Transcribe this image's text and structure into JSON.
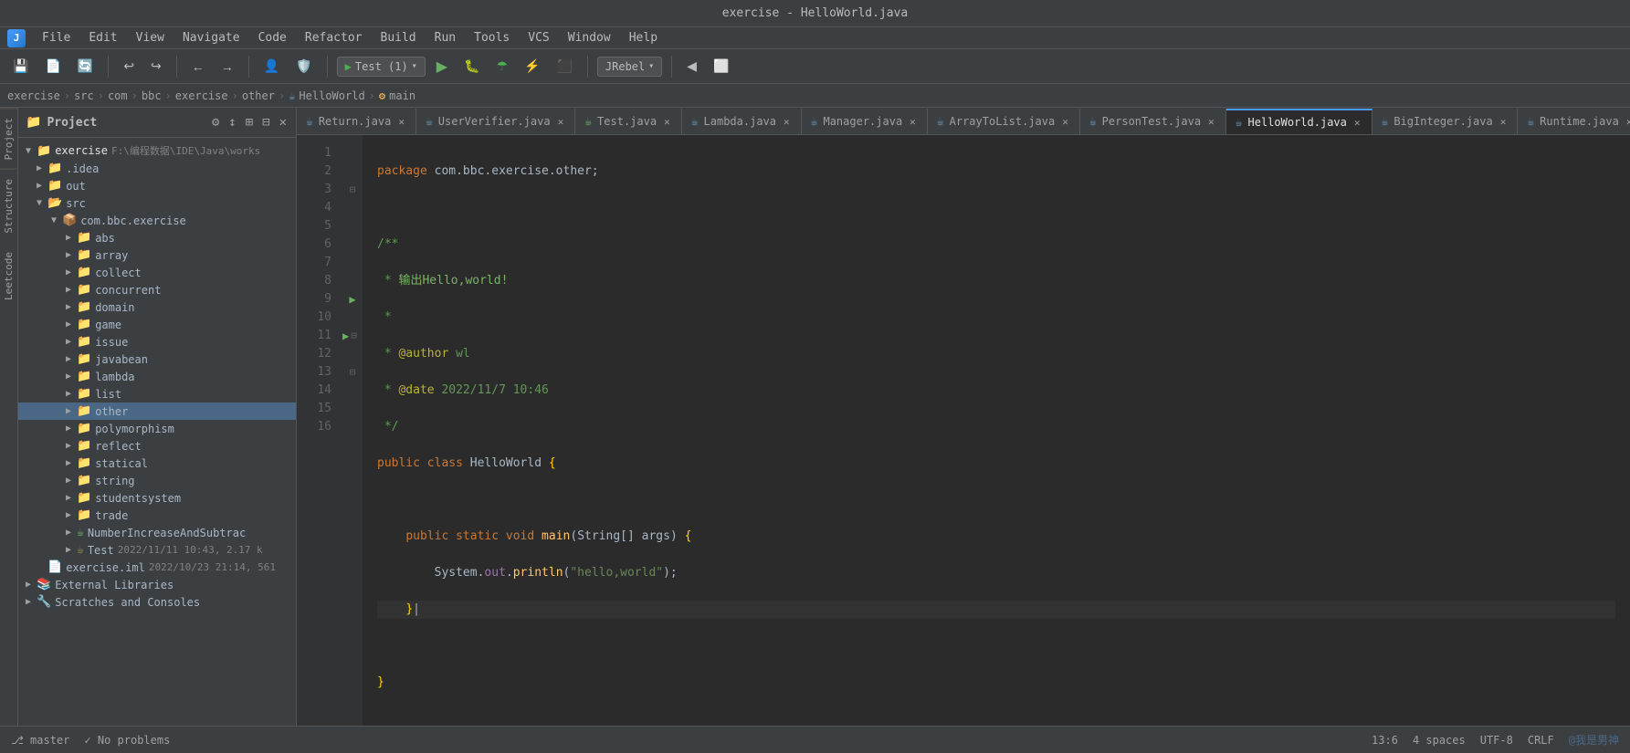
{
  "titlebar": {
    "title": "exercise - HelloWorld.java"
  },
  "menubar": {
    "items": [
      "File",
      "Edit",
      "View",
      "Navigate",
      "Code",
      "Refactor",
      "Build",
      "Run",
      "Tools",
      "VCS",
      "Window",
      "Help"
    ]
  },
  "toolbar": {
    "run_config": "Test (1)",
    "jrebel_config": "JRebel",
    "buttons": [
      "save-all",
      "synchronize",
      "undo",
      "redo",
      "back",
      "forward",
      "update-project",
      "run",
      "debug",
      "run-coverage",
      "profile",
      "stop-run",
      "stop"
    ]
  },
  "breadcrumb": {
    "items": [
      "exercise",
      "src",
      "com",
      "bbc",
      "exercise",
      "other",
      "HelloWorld",
      "main"
    ]
  },
  "project_panel": {
    "title": "Project",
    "tree": [
      {
        "level": 0,
        "type": "root",
        "label": "exercise",
        "extra": "F:\\编程数据\\IDE\\Java\\works",
        "expanded": true
      },
      {
        "level": 1,
        "type": "folder",
        "label": ".idea",
        "expanded": false
      },
      {
        "level": 1,
        "type": "folder",
        "label": "out",
        "expanded": false
      },
      {
        "level": 1,
        "type": "src",
        "label": "src",
        "expanded": true
      },
      {
        "level": 2,
        "type": "package",
        "label": "com.bbc.exercise",
        "expanded": true
      },
      {
        "level": 3,
        "type": "folder",
        "label": "abs",
        "expanded": false
      },
      {
        "level": 3,
        "type": "folder",
        "label": "array",
        "expanded": false
      },
      {
        "level": 3,
        "type": "folder",
        "label": "collect",
        "expanded": false
      },
      {
        "level": 3,
        "type": "folder",
        "label": "concurrent",
        "expanded": false
      },
      {
        "level": 3,
        "type": "folder",
        "label": "domain",
        "expanded": false
      },
      {
        "level": 3,
        "type": "folder",
        "label": "game",
        "expanded": false
      },
      {
        "level": 3,
        "type": "folder",
        "label": "issue",
        "expanded": false
      },
      {
        "level": 3,
        "type": "folder",
        "label": "javabean",
        "expanded": false
      },
      {
        "level": 3,
        "type": "folder",
        "label": "lambda",
        "expanded": false
      },
      {
        "level": 3,
        "type": "folder",
        "label": "list",
        "expanded": false
      },
      {
        "level": 3,
        "type": "folder",
        "label": "other",
        "expanded": false,
        "selected": true
      },
      {
        "level": 3,
        "type": "folder",
        "label": "polymorphism",
        "expanded": false
      },
      {
        "level": 3,
        "type": "folder",
        "label": "reflect",
        "expanded": false
      },
      {
        "level": 3,
        "type": "folder",
        "label": "statical",
        "expanded": false
      },
      {
        "level": 3,
        "type": "folder",
        "label": "string",
        "expanded": false
      },
      {
        "level": 3,
        "type": "folder",
        "label": "studentsystem",
        "expanded": false
      },
      {
        "level": 3,
        "type": "folder",
        "label": "trade",
        "expanded": false
      },
      {
        "level": 3,
        "type": "java_special",
        "label": "NumberIncreaseAndSubtrac",
        "extra": "",
        "expanded": false
      },
      {
        "level": 3,
        "type": "java_test",
        "label": "Test",
        "extra": "2022/11/11 10:43, 2.17 k",
        "expanded": false
      },
      {
        "level": 1,
        "type": "iml",
        "label": "exercise.iml",
        "extra": "2022/10/23 21:14, 561"
      },
      {
        "level": 0,
        "type": "folder",
        "label": "External Libraries",
        "expanded": false
      },
      {
        "level": 0,
        "type": "scratches",
        "label": "Scratches and Consoles",
        "expanded": false
      }
    ]
  },
  "tabs": [
    {
      "label": "Return.java",
      "icon": "java",
      "modified": false,
      "active": false
    },
    {
      "label": "UserVerifier.java",
      "icon": "java",
      "modified": false,
      "active": false
    },
    {
      "label": "Test.java",
      "icon": "java-green",
      "modified": false,
      "active": false
    },
    {
      "label": "Lambda.java",
      "icon": "java",
      "modified": false,
      "active": false
    },
    {
      "label": "Manager.java",
      "icon": "java",
      "modified": false,
      "active": false
    },
    {
      "label": "ArrayToList.java",
      "icon": "java",
      "modified": false,
      "active": false
    },
    {
      "label": "PersonTest.java",
      "icon": "java",
      "modified": false,
      "active": false
    },
    {
      "label": "HelloWorld.java",
      "icon": "java",
      "modified": false,
      "active": true
    },
    {
      "label": "BigInteger.java",
      "icon": "java",
      "modified": false,
      "active": false
    },
    {
      "label": "Runtime.java",
      "icon": "java",
      "modified": false,
      "active": false
    }
  ],
  "editor": {
    "filename": "HelloWorld.java",
    "lines": [
      {
        "num": 1,
        "code": "package com.bbc.exercise.other;"
      },
      {
        "num": 2,
        "code": ""
      },
      {
        "num": 3,
        "code": "/**"
      },
      {
        "num": 4,
        "code": " * 输出Hello,world!"
      },
      {
        "num": 5,
        "code": " *"
      },
      {
        "num": 6,
        "code": " * @author wl"
      },
      {
        "num": 7,
        "code": " * @date 2022/11/7 10:46"
      },
      {
        "num": 8,
        "code": " */"
      },
      {
        "num": 9,
        "code": "public class HelloWorld {"
      },
      {
        "num": 10,
        "code": ""
      },
      {
        "num": 11,
        "code": "    public static void main(String[] args) {"
      },
      {
        "num": 12,
        "code": "        System.out.println(\"hello,world\");"
      },
      {
        "num": 13,
        "code": "    }"
      },
      {
        "num": 14,
        "code": ""
      },
      {
        "num": 15,
        "code": "}"
      },
      {
        "num": 16,
        "code": ""
      }
    ]
  },
  "statusbar": {
    "encoding": "UTF-8",
    "line_separator": "CRLF",
    "position": "13:6",
    "indent": "4 spaces",
    "watermark": "@我是男神"
  },
  "bottombar": {
    "tabs": [
      "Scratches and Consoles"
    ]
  }
}
